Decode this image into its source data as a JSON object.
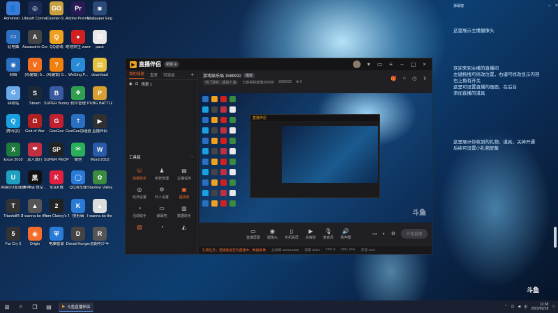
{
  "desktop": {
    "notes_top_right": {
      "line1": "这里展示主播摄像头"
    },
    "notes_right_mid": [
      "欢迎来到主播的直播间",
      "左键拖拽可修改位置，右键可修改显示内容",
      "右上角有开关",
      "这里可设置直播的画面，在后台",
      "添加直播的道具"
    ],
    "notes_right_low": [
      "这里展示你收到的礼物、道具，关掉开通",
      "后续可设置小礼物屏蔽"
    ],
    "icons": [
      {
        "label": "Administr...",
        "icon": "admin-icon",
        "color": "#3a7bd5",
        "glyph": "👤"
      },
      {
        "label": "Ubisoft Connect",
        "icon": "ubisoft-icon",
        "color": "#1b2b55",
        "glyph": "◎"
      },
      {
        "label": "Counter-S...",
        "icon": "counter-strike-icon",
        "color": "#c8a040",
        "glyph": "GO"
      },
      {
        "label": "Adobe Premie...",
        "icon": "premiere-icon",
        "color": "#2a1a55",
        "glyph": "Pr"
      },
      {
        "label": "Wallpaper Engine",
        "icon": "wallpaper-engine-icon",
        "color": "#2b4a7a",
        "glyph": "◙"
      },
      {
        "label": "此电脑",
        "icon": "computer-icon",
        "color": "#2a6fc0",
        "glyph": "▭"
      },
      {
        "label": "Assassin's Creed V...",
        "icon": "assassins-creed-icon",
        "color": "#444",
        "glyph": "A"
      },
      {
        "label": "QQ游戏",
        "icon": "qq-game-icon",
        "color": "#f0a020",
        "glyph": "Q"
      },
      {
        "label": "绝地求生 wanna pl...",
        "icon": "pubg-icon",
        "color": "#d02020",
        "glyph": "●"
      },
      {
        "label": "pack",
        "icon": "folder-icon",
        "color": "#e8e8e8",
        "glyph": "▤"
      },
      {
        "label": "网络",
        "icon": "network-icon",
        "color": "#2a6fc0",
        "glyph": "◉"
      },
      {
        "label": "(鸡腿饭) 5...",
        "icon": "game-v-icon",
        "color": "#f07020",
        "glyph": "V"
      },
      {
        "label": "(鸡腿饭) 5...",
        "icon": "game-orange-icon",
        "color": "#f08010",
        "glyph": "?"
      },
      {
        "label": "WeSing P...",
        "icon": "wesing-icon",
        "color": "#2a8ad5",
        "glyph": "✓"
      },
      {
        "label": "download",
        "icon": "download-folder-icon",
        "color": "#e6c040",
        "glyph": "▤"
      },
      {
        "label": "回收站",
        "icon": "recycle-bin-icon",
        "color": "#6aa8e8",
        "glyph": "♻"
      },
      {
        "label": "Steam",
        "icon": "steam-icon",
        "color": "#1b2838",
        "glyph": "S"
      },
      {
        "label": "SUPER Bunny Man",
        "icon": "super-bunny-icon",
        "color": "#3a5aa0",
        "glyph": "B"
      },
      {
        "label": "软件管理",
        "icon": "software-manager-icon",
        "color": "#30a050",
        "glyph": "❖"
      },
      {
        "label": "PUBG BATTLEG...",
        "icon": "battlegrounds-icon",
        "color": "#d8a030",
        "glyph": "P"
      },
      {
        "label": "腾讯QQ",
        "icon": "qq-icon",
        "color": "#1aa0e0",
        "glyph": "Q"
      },
      {
        "label": "God of War",
        "icon": "god-of-war-icon",
        "color": "#b02020",
        "glyph": "Ω"
      },
      {
        "label": "GeeGee",
        "icon": "geegee-icon",
        "color": "#c02030",
        "glyph": "G"
      },
      {
        "label": "GeeGee加速器",
        "icon": "geegee-accel-icon",
        "color": "#2a6fc0",
        "glyph": "⇡"
      },
      {
        "label": "直播伴侣",
        "icon": "live-partner-icon",
        "color": "#303030",
        "glyph": "▶"
      },
      {
        "label": "Excel 2010",
        "icon": "excel-icon",
        "color": "#1f7a3e",
        "glyph": "X"
      },
      {
        "label": "双人成行",
        "icon": "it-takes-two-icon",
        "color": "#c03040",
        "glyph": "❤"
      },
      {
        "label": "SUPER PEOPLE CBT",
        "icon": "super-people-icon",
        "color": "#222",
        "glyph": "SP"
      },
      {
        "label": "微信",
        "icon": "wechat-icon",
        "color": "#2aae5a",
        "glyph": "✉"
      },
      {
        "label": "Word 2010",
        "icon": "word-icon",
        "color": "#2a5aa8",
        "glyph": "W"
      },
      {
        "label": "网易UU加速器",
        "icon": "uu-accel-icon",
        "color": "#20a0c0",
        "glyph": "U"
      },
      {
        "label": "黑神话 悟空...",
        "icon": "black-myth-icon",
        "color": "#111",
        "glyph": "黑"
      },
      {
        "label": "全民K歌",
        "icon": "karaoke-icon",
        "color": "#e02040",
        "glyph": "K"
      },
      {
        "label": "QQ浏览器",
        "icon": "qq-browser-icon",
        "color": "#2a7ad8",
        "glyph": "◯"
      },
      {
        "label": "Stardew Valley",
        "icon": "stardew-icon",
        "color": "#3a8a40",
        "glyph": "✿"
      },
      {
        "label": "Titanfall® 2",
        "icon": "titanfall-icon",
        "color": "#333",
        "glyph": "T"
      },
      {
        "label": "I wanna be the DARK...",
        "icon": "iwanna-dark-icon",
        "color": "#555",
        "glyph": "▲"
      },
      {
        "label": "Tom Clancy's T...",
        "icon": "tom-clancy-icon",
        "color": "#222",
        "glyph": "2"
      },
      {
        "label": "快剪辑",
        "icon": "kuaijianji-icon",
        "color": "#2a7ad8",
        "glyph": "K"
      },
      {
        "label": "I wanna be the Creator",
        "icon": "iwanna-creator-icon",
        "color": "#ddd",
        "glyph": "▲"
      },
      {
        "label": "Far Cry 5",
        "icon": "far-cry-icon",
        "color": "#333",
        "glyph": "5"
      },
      {
        "label": "Origin",
        "icon": "origin-icon",
        "color": "#f56c2d",
        "glyph": "◉"
      },
      {
        "label": "电脑管家",
        "icon": "pc-manager-icon",
        "color": "#2a7ad8",
        "glyph": "⛨"
      },
      {
        "label": "Dread Hunger",
        "icon": "dread-hunger-icon",
        "color": "#444",
        "glyph": "D"
      },
      {
        "label": "逃跑吧少年",
        "icon": "escape-boy-icon",
        "color": "#555",
        "glyph": "R"
      }
    ]
  },
  "app": {
    "name": "直播伴侣",
    "version_tag": "新版 ⊕",
    "tabs": [
      "我的场景",
      "直来",
      "可添加"
    ],
    "scene_name": "场景 1",
    "tools_title": "工具箱",
    "tools": [
      {
        "label": "连麦助手",
        "icon": "co-stream-icon",
        "glyph": "☏",
        "hot": true
      },
      {
        "label": "房管管理",
        "icon": "room-admin-icon",
        "glyph": "♟",
        "hot": false
      },
      {
        "label": "主播任务",
        "icon": "anchor-task-icon",
        "glyph": "▤",
        "hot": false
      },
      {
        "label": "玩法设置",
        "icon": "gameplay-settings-icon",
        "glyph": "◎",
        "hot": false
      },
      {
        "label": "外人设置",
        "icon": "outsider-settings-icon",
        "glyph": "⚙",
        "hot": false
      },
      {
        "label": "福袋商",
        "icon": "lucky-bag-icon",
        "glyph": "▣",
        "hot": true
      },
      {
        "label": "活动助手",
        "icon": "activity-helper-icon",
        "glyph": "◔",
        "hot": false
      },
      {
        "label": "弹幕吧",
        "icon": "danmaku-icon",
        "glyph": "▭",
        "hot": false
      },
      {
        "label": "数据助手",
        "icon": "data-helper-icon",
        "glyph": "▥",
        "hot": false
      },
      {
        "label": "",
        "icon": "extra-tool-1-icon",
        "glyph": "▧",
        "hot": true
      },
      {
        "label": "",
        "icon": "extra-tool-2-icon",
        "glyph": "◔",
        "hot": false
      },
      {
        "label": "",
        "icon": "extra-tool-3-icon",
        "glyph": "◭",
        "hot": false
      }
    ],
    "stream_title": "游戏娱乐局 1589932",
    "stream_tag": "播放",
    "meta": [
      "热门游戏 · 超级人海",
      "已获得热度值200/88",
      "1589932",
      "⊕ 0"
    ],
    "bottom_items": [
      {
        "label": "直播屏幕",
        "icon": "screen-share-icon",
        "glyph": "▭"
      },
      {
        "label": "摄像头",
        "icon": "camera-icon",
        "glyph": "◉"
      },
      {
        "label": "手机投屏",
        "icon": "phone-cast-icon",
        "glyph": "▯"
      },
      {
        "label": "多媒体",
        "icon": "media-icon",
        "glyph": "▶"
      },
      {
        "label": "麦克风",
        "icon": "microphone-icon",
        "glyph": "🎙"
      },
      {
        "label": "扬声器",
        "icon": "speaker-icon",
        "glyph": "🔊"
      }
    ],
    "start_label": "开始直播",
    "status_warn": "礼物任务，把播放设定为直播中，数据录像",
    "status_items": [
      "分辨率 1920x1080",
      "码率 0kb/s",
      "FPS 0",
      "CPU 20%",
      "内存 42%",
      "帧率 0fps"
    ],
    "watermark": "斗鱼"
  },
  "side_panel": {
    "title": "弹幕窗"
  },
  "taskbar": {
    "app_label": "斗鱼直播伴侣",
    "time": "11:38",
    "date": "2022/02/18"
  },
  "corner_logo": "斗鱼"
}
